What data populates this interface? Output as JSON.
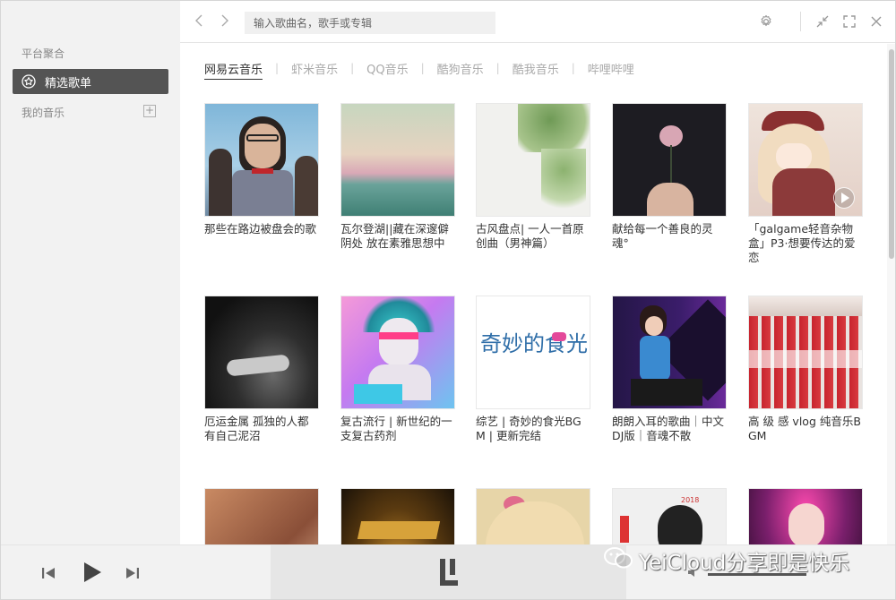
{
  "sidebar": {
    "section_platform": "平台聚合",
    "active_item": "精选歌单",
    "section_my_music": "我的音乐",
    "add_symbol": "+"
  },
  "topbar": {
    "search_placeholder": "输入歌曲名，歌手或专辑",
    "back_icon": "chevron-left-icon",
    "forward_icon": "chevron-right-icon"
  },
  "tabs": [
    {
      "label": "网易云音乐",
      "active": true
    },
    {
      "label": "虾米音乐",
      "active": false
    },
    {
      "label": "QQ音乐",
      "active": false
    },
    {
      "label": "酷狗音乐",
      "active": false
    },
    {
      "label": "酷我音乐",
      "active": false
    },
    {
      "label": "哔哩哔哩",
      "active": false
    }
  ],
  "playlists": [
    {
      "title": "那些在路边被盘会的歌"
    },
    {
      "title": "瓦尔登湖||藏在深邃僻阴处 放在素雅思想中"
    },
    {
      "title": "古风盘点| 一人一首原创曲（男神篇）"
    },
    {
      "title": "献给每一个善良的灵魂°"
    },
    {
      "title": "「galgame轻音杂物盒」P3·想要传达的爱恋"
    },
    {
      "title": "厄运金属 孤独的人都有自己泥沼"
    },
    {
      "title": "复古流行 | 新世纪的一支复古药剂"
    },
    {
      "title": "综艺 | 奇妙的食光BGM | 更新完结"
    },
    {
      "title": "朗朗入耳的歌曲｜中文DJ版｜音魂不散"
    },
    {
      "title": "高 级 感 vlog 纯音乐BGM"
    },
    {
      "title": ""
    },
    {
      "title": ""
    },
    {
      "title": ""
    },
    {
      "title": ""
    },
    {
      "title": ""
    }
  ],
  "cover_text": {
    "food_show": "奇妙的食光",
    "year": "2018"
  },
  "watermark": {
    "text": "YeiCloud分享即是快乐"
  },
  "colors": {
    "sidebar_bg": "#f2f2f2",
    "active_item_bg": "#545454",
    "accent_text": "#333333"
  }
}
